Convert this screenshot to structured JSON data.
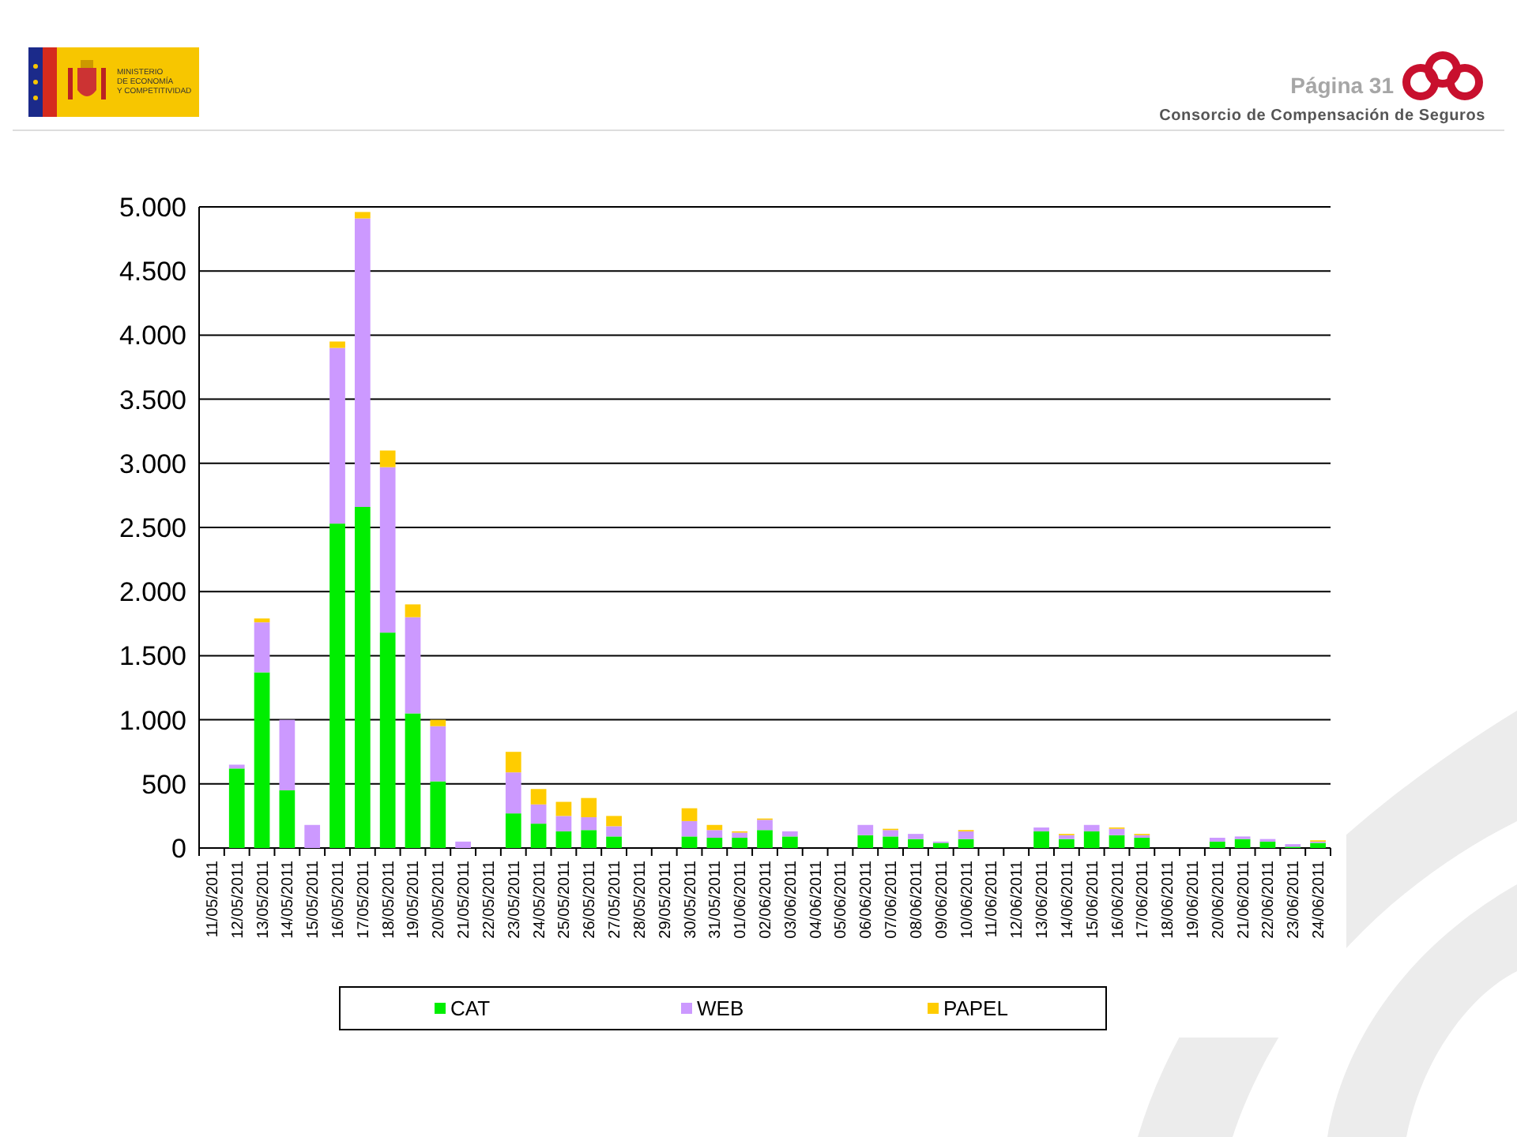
{
  "header": {
    "ministry_logo_lines": [
      "MINISTERIO",
      "DE ECONOMÍA",
      "Y COMPETITIVIDAD"
    ],
    "page_label": "Página 31",
    "organization": "Consorcio de Compensación de Seguros"
  },
  "chart": {
    "chart_data": {
      "type": "bar",
      "stacked": true,
      "orientation": "vertical",
      "grid": {
        "y": true
      },
      "legend": true,
      "categories": [
        "11/05/2011",
        "12/05/2011",
        "13/05/2011",
        "14/05/2011",
        "15/05/2011",
        "16/05/2011",
        "17/05/2011",
        "18/05/2011",
        "19/05/2011",
        "20/05/2011",
        "21/05/2011",
        "22/05/2011",
        "23/05/2011",
        "24/05/2011",
        "25/05/2011",
        "26/05/2011",
        "27/05/2011",
        "28/05/2011",
        "29/05/2011",
        "30/05/2011",
        "31/05/2011",
        "01/06/2011",
        "02/06/2011",
        "03/06/2011",
        "04/06/2011",
        "05/06/2011",
        "06/06/2011",
        "07/06/2011",
        "08/06/2011",
        "09/06/2011",
        "10/06/2011",
        "11/06/2011",
        "12/06/2011",
        "13/06/2011",
        "14/06/2011",
        "15/06/2011",
        "16/06/2011",
        "17/06/2011",
        "18/06/2011",
        "19/06/2011",
        "20/06/2011",
        "21/06/2011",
        "22/06/2011",
        "23/06/2011",
        "24/06/2011"
      ],
      "series": [
        {
          "name": "CAT",
          "color": "#00ee00",
          "values": [
            0,
            620,
            1370,
            450,
            0,
            2530,
            2660,
            1680,
            1050,
            520,
            0,
            0,
            270,
            190,
            130,
            140,
            90,
            0,
            0,
            90,
            80,
            80,
            140,
            90,
            0,
            0,
            100,
            90,
            70,
            40,
            70,
            0,
            0,
            130,
            70,
            130,
            100,
            80,
            0,
            0,
            50,
            70,
            50,
            10,
            40
          ]
        },
        {
          "name": "WEB",
          "color": "#cc99ff",
          "values": [
            0,
            30,
            390,
            550,
            180,
            1370,
            2250,
            1290,
            750,
            430,
            50,
            0,
            320,
            150,
            120,
            100,
            80,
            0,
            0,
            120,
            60,
            40,
            80,
            40,
            0,
            0,
            80,
            50,
            40,
            10,
            60,
            0,
            0,
            30,
            30,
            50,
            50,
            20,
            0,
            0,
            30,
            20,
            20,
            20,
            10
          ]
        },
        {
          "name": "PAPEL",
          "color": "#ffcc00",
          "values": [
            0,
            0,
            30,
            0,
            0,
            50,
            50,
            130,
            100,
            50,
            0,
            0,
            160,
            120,
            110,
            150,
            80,
            0,
            0,
            100,
            40,
            10,
            10,
            0,
            0,
            0,
            0,
            10,
            0,
            0,
            10,
            0,
            0,
            0,
            10,
            0,
            10,
            10,
            0,
            0,
            0,
            0,
            0,
            0,
            10
          ]
        }
      ],
      "ylim": [
        0,
        5000
      ],
      "yticks": [
        {
          "value": 0,
          "label": "0"
        },
        {
          "value": 500,
          "label": "500"
        },
        {
          "value": 1000,
          "label": "1.000"
        },
        {
          "value": 1500,
          "label": "1.500"
        },
        {
          "value": 2000,
          "label": "2.000"
        },
        {
          "value": 2500,
          "label": "2.500"
        },
        {
          "value": 3000,
          "label": "3.000"
        },
        {
          "value": 3500,
          "label": "3.500"
        },
        {
          "value": 4000,
          "label": "4.000"
        },
        {
          "value": 4500,
          "label": "4.500"
        },
        {
          "value": 5000,
          "label": "5.000"
        }
      ]
    }
  }
}
